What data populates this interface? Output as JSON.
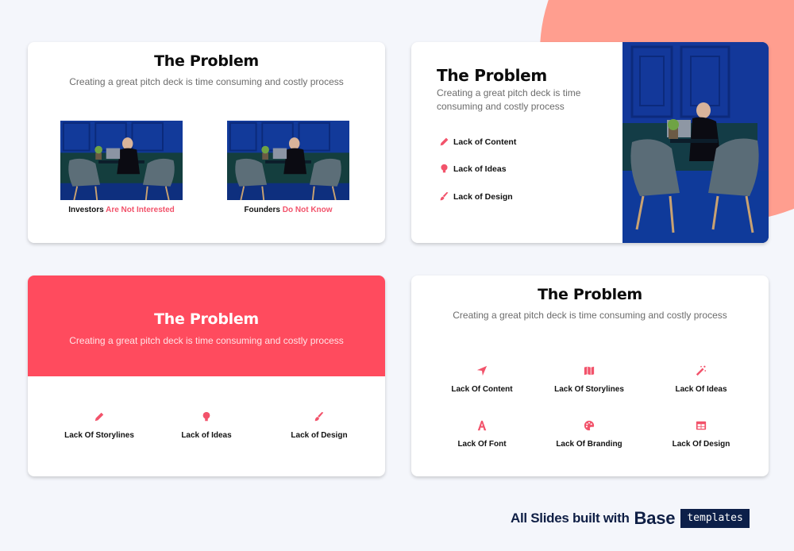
{
  "colors": {
    "accent": "#f2536b",
    "banner": "#ff4b5e",
    "blob": "#ff9e8f",
    "footer_dark": "#0c1f49",
    "background": "#f4f6fb"
  },
  "slides": [
    {
      "title": "The Problem",
      "subtitle": "Creating a great pitch deck is time consuming and costly process",
      "images": [
        {
          "caption_lead": "Investors",
          "caption_accent": "Are Not Interested"
        },
        {
          "caption_lead": "Founders",
          "caption_accent": "Do Not Know"
        }
      ]
    },
    {
      "title": "The Problem",
      "subtitle": "Creating a great pitch deck is time consuming and costly process",
      "items": [
        {
          "icon": "pencil-icon",
          "label": "Lack of Content"
        },
        {
          "icon": "lightbulb-icon",
          "label": "Lack of Ideas"
        },
        {
          "icon": "paintbrush-icon",
          "label": "Lack of Design"
        }
      ]
    },
    {
      "title": "The Problem",
      "subtitle": "Creating a great pitch deck is time consuming and costly process",
      "items": [
        {
          "icon": "pencil-icon",
          "label": "Lack Of Storylines"
        },
        {
          "icon": "lightbulb-icon",
          "label": "Lack of Ideas"
        },
        {
          "icon": "paintbrush-icon",
          "label": "Lack of Design"
        }
      ]
    },
    {
      "title": "The Problem",
      "subtitle": "Creating a great pitch deck is time consuming and costly process",
      "items": [
        {
          "icon": "location-arrow-icon",
          "label": "Lack Of Content"
        },
        {
          "icon": "map-icon",
          "label": "Lack Of Storylines"
        },
        {
          "icon": "magic-wand-icon",
          "label": "Lack Of Ideas"
        },
        {
          "icon": "font-icon",
          "label": "Lack Of Font"
        },
        {
          "icon": "palette-icon",
          "label": "Lack Of Branding"
        },
        {
          "icon": "table-icon",
          "label": "Lack Of Design"
        }
      ]
    }
  ],
  "footer": {
    "lead": "All Slides built with",
    "brand": "Base",
    "tag": "templates"
  }
}
